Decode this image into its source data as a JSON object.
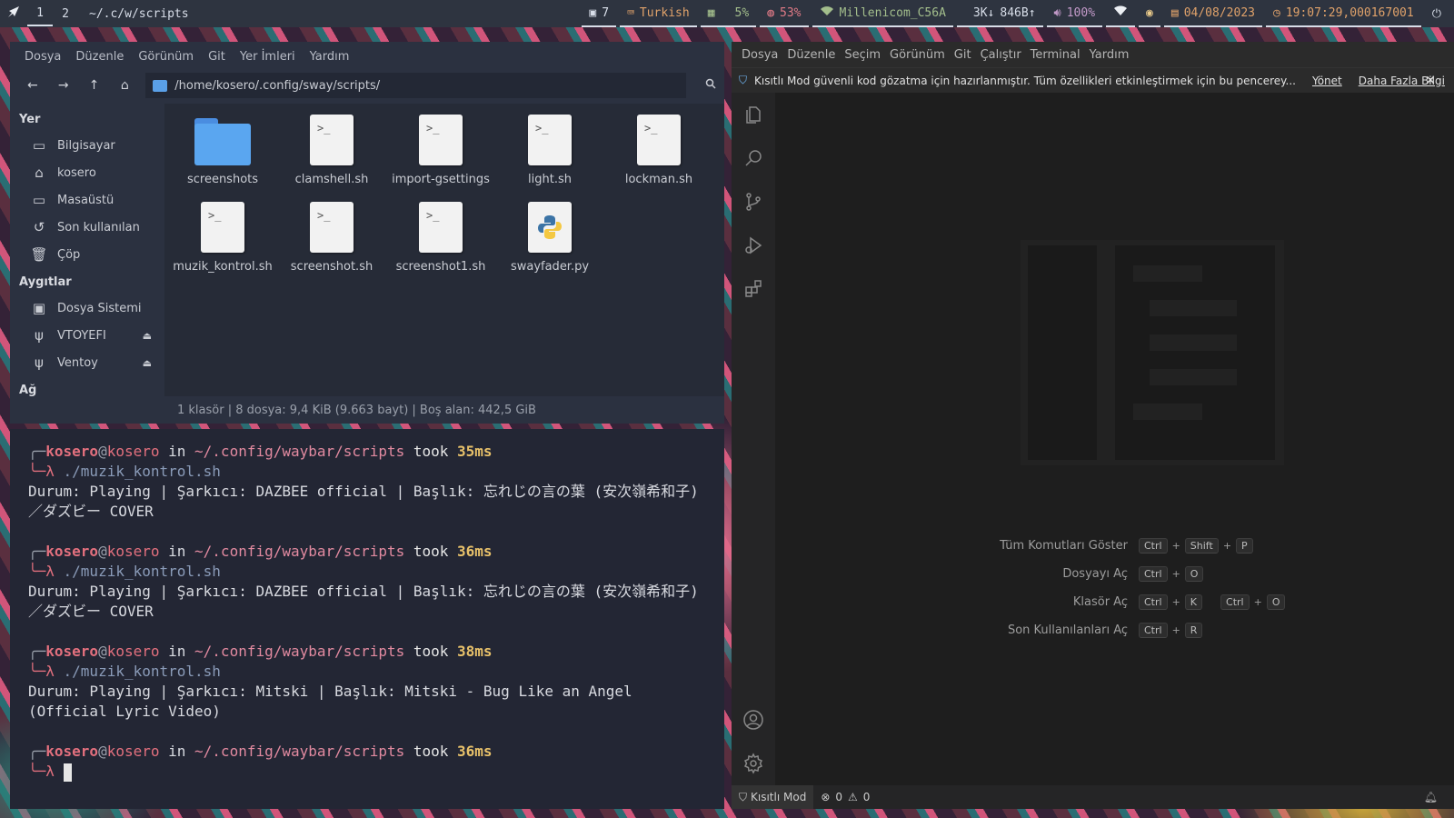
{
  "topbar": {
    "workspaces": [
      "1",
      "2"
    ],
    "path": "~/.c/w/scripts",
    "notifications": "7",
    "keyboard": "Turkish",
    "cpu": "5%",
    "memory": "53%",
    "wifi": "Millenicom_C56A",
    "net_down": "3K↓",
    "net_up": "846B↑",
    "volume": "100%",
    "date": "04/08/2023",
    "time": "19:07:29,000167001"
  },
  "filemanager": {
    "menu": [
      "Dosya",
      "Düzenle",
      "Görünüm",
      "Git",
      "Yer İmleri",
      "Yardım"
    ],
    "location": "/home/kosero/.config/sway/scripts/",
    "sidebar": {
      "places_header": "Yer",
      "places": [
        {
          "label": "Bilgisayar",
          "icon": "computer-icon"
        },
        {
          "label": "kosero",
          "icon": "home-icon"
        },
        {
          "label": "Masaüstü",
          "icon": "desktop-icon"
        },
        {
          "label": "Son kullanılan",
          "icon": "recent-icon"
        },
        {
          "label": "Çöp",
          "icon": "trash-icon"
        }
      ],
      "devices_header": "Aygıtlar",
      "devices": [
        {
          "label": "Dosya Sistemi",
          "icon": "drive-icon"
        },
        {
          "label": "VTOYEFI",
          "icon": "usb-icon"
        },
        {
          "label": "Ventoy",
          "icon": "usb-icon"
        }
      ],
      "network_header": "Ağ"
    },
    "files": [
      {
        "name": "screenshots",
        "type": "folder"
      },
      {
        "name": "clamshell.sh",
        "type": "script"
      },
      {
        "name": "import-gsettings",
        "type": "script"
      },
      {
        "name": "light.sh",
        "type": "script"
      },
      {
        "name": "lockman.sh",
        "type": "script"
      },
      {
        "name": "muzik_kontrol.sh",
        "type": "script"
      },
      {
        "name": "screenshot.sh",
        "type": "script"
      },
      {
        "name": "screenshot1.sh",
        "type": "script"
      },
      {
        "name": "swayfader.py",
        "type": "python"
      }
    ],
    "script_glyph": ">_",
    "status": "1 klasör  |  8 dosya: 9,4 KiB (9.663 bayt)  |  Boş alan: 442,5 GiB"
  },
  "terminal": {
    "blocks": [
      {
        "user": "kosero",
        "at": "@",
        "host": "kosero",
        "in": " in ",
        "path": "~/.config/waybar/scripts",
        "took": " took ",
        "ms": "35ms",
        "cmd": "./muzik_kontrol.sh",
        "output": "Durum: Playing | Şarkıcı: DAZBEE official | Başlık: 忘れじの言の葉 (安次嶺希和子) ／ダズビー COVER"
      },
      {
        "user": "kosero",
        "at": "@",
        "host": "kosero",
        "in": " in ",
        "path": "~/.config/waybar/scripts",
        "took": " took ",
        "ms": "36ms",
        "cmd": "./muzik_kontrol.sh",
        "output": "Durum: Playing | Şarkıcı: DAZBEE official | Başlık: 忘れじの言の葉 (安次嶺希和子) ／ダズビー COVER"
      },
      {
        "user": "kosero",
        "at": "@",
        "host": "kosero",
        "in": " in ",
        "path": "~/.config/waybar/scripts",
        "took": " took ",
        "ms": "38ms",
        "cmd": "./muzik_kontrol.sh",
        "output": "Durum: Playing | Şarkıcı: Mitski | Başlık: Mitski - Bug Like an Angel (Official Lyric Video)"
      },
      {
        "user": "kosero",
        "at": "@",
        "host": "kosero",
        "in": " in ",
        "path": "~/.config/waybar/scripts",
        "took": " took ",
        "ms": "36ms",
        "cmd": "",
        "output": ""
      }
    ],
    "prompt_top": "╭─",
    "prompt_bottom": "╰─λ "
  },
  "vscode": {
    "menu": [
      "Dosya",
      "Düzenle",
      "Seçim",
      "Görünüm",
      "Git",
      "Çalıştır",
      "Terminal",
      "Yardım"
    ],
    "banner": {
      "text": "Kısıtlı Mod güvenli kod gözatma için hazırlanmıştır. Tüm özellikleri etkinleştirmek için bu pencerey...",
      "manage": "Yönet",
      "learn_more": "Daha Fazla Bilgi"
    },
    "shortcuts": [
      {
        "label": "Tüm Komutları Göster",
        "keys": [
          [
            "Ctrl",
            "Shift",
            "P"
          ]
        ]
      },
      {
        "label": "Dosyayı Aç",
        "keys": [
          [
            "Ctrl",
            "O"
          ]
        ]
      },
      {
        "label": "Klasör Aç",
        "keys": [
          [
            "Ctrl",
            "K"
          ],
          [
            "Ctrl",
            "O"
          ]
        ]
      },
      {
        "label": "Son Kullanılanları Aç",
        "keys": [
          [
            "Ctrl",
            "R"
          ]
        ]
      }
    ],
    "status": {
      "restricted": "Kısıtlı Mod",
      "errors": "0",
      "warnings": "0"
    }
  },
  "colors": {
    "terminal_user": "#e3707e",
    "terminal_time": "#e8c16a",
    "folder": "#5aa6f0",
    "vscode_accent": "#75beff"
  }
}
